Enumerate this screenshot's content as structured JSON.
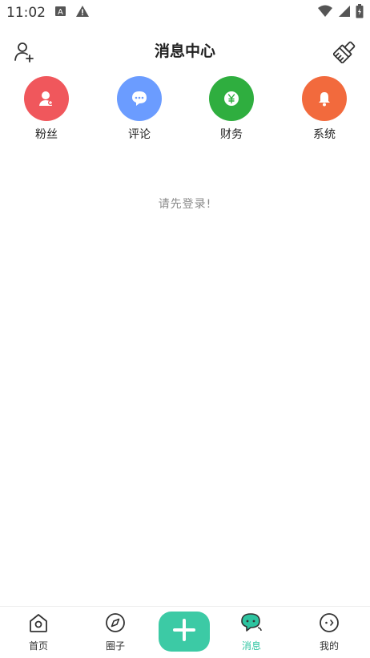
{
  "status_bar": {
    "time": "11:02",
    "left_icons": [
      "a-notification-icon",
      "warning-icon"
    ],
    "right_icons": [
      "wifi-icon",
      "signal-icon",
      "battery-icon"
    ]
  },
  "header": {
    "title": "消息中心",
    "left_icon": "add-friend-icon",
    "right_icon": "clear-brush-icon"
  },
  "categories": [
    {
      "label": "粉丝",
      "icon": "fans-icon",
      "color": "#f0575c"
    },
    {
      "label": "评论",
      "icon": "comment-icon",
      "color": "#6b9cff"
    },
    {
      "label": "财务",
      "icon": "finance-icon",
      "color": "#2fae3f"
    },
    {
      "label": "系统",
      "icon": "bell-icon",
      "color": "#f26a3d"
    }
  ],
  "empty_message": "请先登录!",
  "bottom_nav": {
    "items": [
      {
        "label": "首页",
        "icon": "home-icon"
      },
      {
        "label": "圈子",
        "icon": "compass-icon"
      },
      {
        "label": "消息",
        "icon": "message-icon",
        "active": true
      },
      {
        "label": "我的",
        "icon": "profile-icon"
      }
    ],
    "plus_icon": "plus-icon",
    "accent_color": "#2ec4a0"
  }
}
